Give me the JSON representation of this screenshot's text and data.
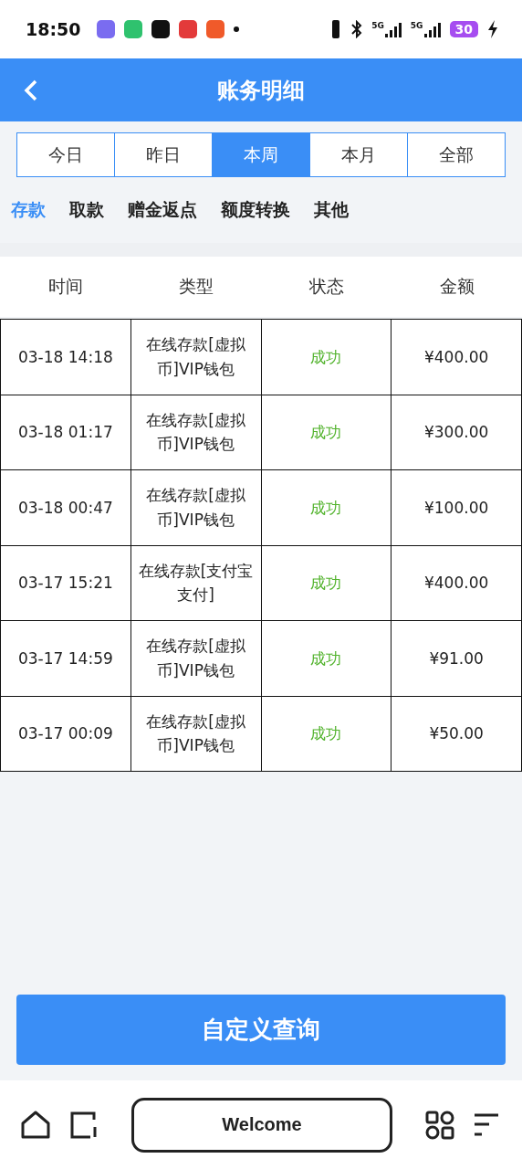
{
  "status_bar": {
    "time": "18:50",
    "network_labels": [
      "5G",
      "5G"
    ],
    "battery": "30"
  },
  "header": {
    "title": "账务明细"
  },
  "periods": [
    {
      "label": "今日",
      "selected": false
    },
    {
      "label": "昨日",
      "selected": false
    },
    {
      "label": "本周",
      "selected": true
    },
    {
      "label": "本月",
      "selected": false
    },
    {
      "label": "全部",
      "selected": false
    }
  ],
  "categories": [
    {
      "label": "存款",
      "selected": true
    },
    {
      "label": "取款",
      "selected": false
    },
    {
      "label": "赠金返点",
      "selected": false
    },
    {
      "label": "额度转换",
      "selected": false
    },
    {
      "label": "其他",
      "selected": false
    }
  ],
  "table": {
    "columns": [
      "时间",
      "类型",
      "状态",
      "金额"
    ],
    "rows": [
      {
        "time": "03-18 14:18",
        "type": "在线存款[虚拟币]VIP钱包",
        "status": "成功",
        "amount": "¥400.00"
      },
      {
        "time": "03-18 01:17",
        "type": "在线存款[虚拟币]VIP钱包",
        "status": "成功",
        "amount": "¥300.00"
      },
      {
        "time": "03-18 00:47",
        "type": "在线存款[虚拟币]VIP钱包",
        "status": "成功",
        "amount": "¥100.00"
      },
      {
        "time": "03-17 15:21",
        "type": "在线存款[支付宝支付]",
        "status": "成功",
        "amount": "¥400.00"
      },
      {
        "time": "03-17 14:59",
        "type": "在线存款[虚拟币]VIP钱包",
        "status": "成功",
        "amount": "¥91.00"
      },
      {
        "time": "03-17 00:09",
        "type": "在线存款[虚拟币]VIP钱包",
        "status": "成功",
        "amount": "¥50.00"
      }
    ]
  },
  "query_button": "自定义查询",
  "nav_bar": {
    "center_label": "Welcome"
  }
}
